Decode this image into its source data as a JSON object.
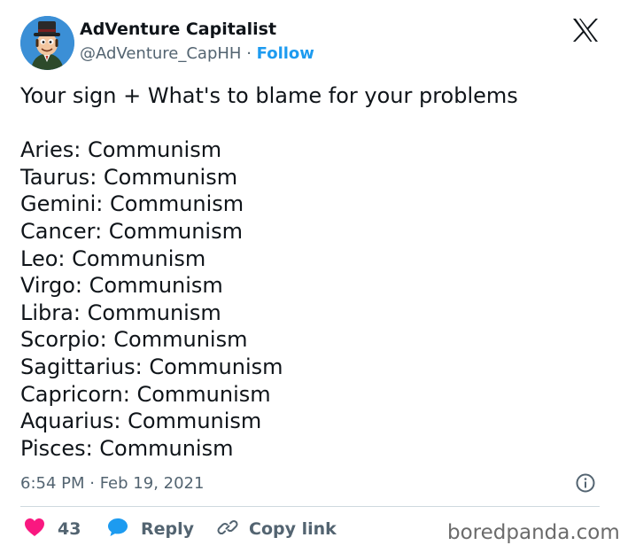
{
  "author": {
    "name": "AdVenture Capitalist",
    "handle": "@AdVenture_CapHH",
    "separator": " · ",
    "follow_label": "Follow"
  },
  "tweet": {
    "intro": "Your sign + What's to blame for your problems",
    "lines": [
      "Aries: Communism",
      "Taurus: Communism",
      "Gemini: Communism",
      "Cancer: Communism",
      "Leo: Communism",
      "Virgo: Communism",
      "Libra: Communism",
      "Scorpio: Communism",
      "Sagittarius: Communism",
      "Capricorn: Communism",
      "Aquarius: Communism",
      "Pisces: Communism"
    ],
    "timestamp": "6:54 PM · Feb 19, 2021"
  },
  "actions": {
    "like_count": "43",
    "reply_label": "Reply",
    "copy_label": "Copy link"
  },
  "watermark": "boredpanda.com",
  "icons": {
    "brand": "x-logo-icon",
    "info": "info-icon",
    "like": "heart-icon",
    "reply": "speech-bubble-icon",
    "copy": "link-icon"
  },
  "colors": {
    "accent": "#1d9bf0",
    "heart": "#f91880",
    "secondary_text": "#536471",
    "divider": "#cfd9de"
  }
}
